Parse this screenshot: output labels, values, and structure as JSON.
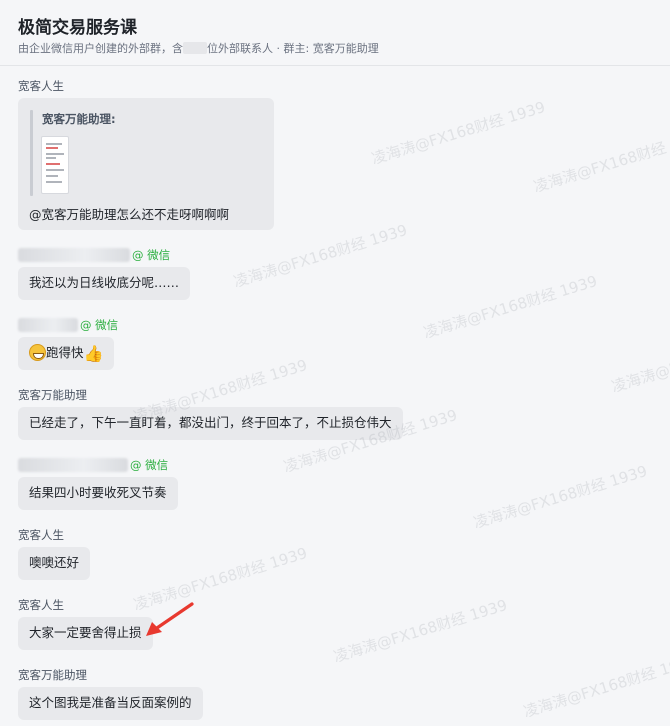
{
  "header": {
    "title": "极简交易服务课",
    "subtitle_pre": "由企业微信用户创建的外部群，含",
    "subtitle_post": "位外部联系人 · 群主: 宽客万能助理"
  },
  "messages": [
    {
      "sender": "宽客人生",
      "quote_name": "宽客万能助理:",
      "text": "@宽客万能助理怎么还不走呀啊啊啊"
    },
    {
      "sender_tag": "@ 微信",
      "text": "我还以为日线收底分呢……"
    },
    {
      "sender_tag": "@ 微信",
      "text": "跑得快"
    },
    {
      "sender": "宽客万能助理",
      "text": "已经走了，下午一直盯着，都没出门，终于回本了，不止损仓伟大"
    },
    {
      "sender_tag": "@ 微信",
      "text": "结果四小时要收死叉节奏"
    },
    {
      "sender": "宽客人生",
      "text": "噢噢还好"
    },
    {
      "sender": "宽客人生",
      "text": "大家一定要舍得止损"
    },
    {
      "sender": "宽客万能助理",
      "text": "这个图我是准备当反面案例的"
    }
  ],
  "watermark": "凌海涛@FX168财经 1939",
  "colors": {
    "wechat_green": "#2bae3f",
    "arrow": "#e8392f",
    "bubble": "#e8e9ec"
  }
}
